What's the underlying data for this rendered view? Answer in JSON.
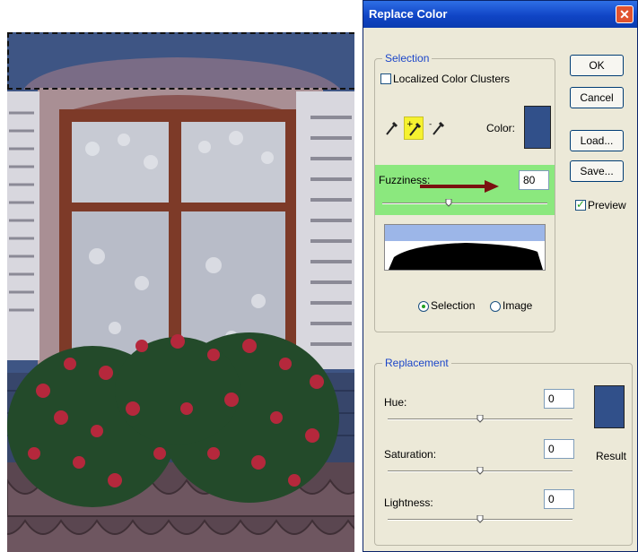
{
  "dialog": {
    "title": "Replace Color",
    "buttons": {
      "ok": "OK",
      "cancel": "Cancel",
      "load": "Load...",
      "save": "Save..."
    },
    "preview": {
      "label": "Preview",
      "checked": true
    }
  },
  "selection": {
    "group_label": "Selection",
    "localized_clusters": {
      "label": "Localized Color Clusters",
      "checked": false
    },
    "eyedroppers": [
      "eyedropper-icon",
      "eyedropper-plus-icon",
      "eyedropper-minus-icon"
    ],
    "active_eyedropper": "eyedropper-plus-icon",
    "color_label": "Color:",
    "color_value": "#31508a",
    "fuzziness_label": "Fuzziness:",
    "fuzziness_value": "80",
    "fuzziness_fraction": 0.4,
    "highlight_color": "#8be87e",
    "annotation_arrow_color": "#7a1010",
    "mode_options": [
      {
        "label": "Selection",
        "selected": true
      },
      {
        "label": "Image",
        "selected": false
      }
    ]
  },
  "replacement": {
    "group_label": "Replacement",
    "hue": {
      "label": "Hue:",
      "value": "0",
      "fraction": 0.5
    },
    "saturation": {
      "label": "Saturation:",
      "value": "0",
      "fraction": 0.5
    },
    "lightness": {
      "label": "Lightness:",
      "value": "0",
      "fraction": 0.5
    },
    "result_label": "Result",
    "result_color": "#31508a"
  },
  "colors": {
    "titlebar": "#1045c6",
    "dialog_bg": "#ece9d8",
    "group_label": "#1c46c9"
  }
}
